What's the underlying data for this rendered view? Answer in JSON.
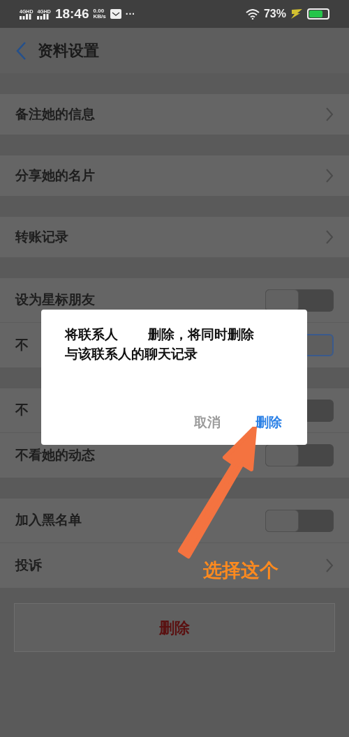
{
  "status_bar": {
    "signals": [
      "4GHD",
      "4GHD"
    ],
    "time": "18:46",
    "speed_value": "0.00",
    "speed_unit": "KB/s",
    "more": "···",
    "battery": "73%"
  },
  "header": {
    "title": "资料设置"
  },
  "groups": [
    {
      "rows": [
        {
          "label": "备注她的信息",
          "kind": "link"
        }
      ]
    },
    {
      "rows": [
        {
          "label": "分享她的名片",
          "kind": "link"
        }
      ]
    },
    {
      "rows": [
        {
          "label": "转账记录",
          "kind": "link"
        }
      ]
    },
    {
      "rows": [
        {
          "label": "设为星标朋友",
          "kind": "toggle",
          "on": false
        },
        {
          "label": "不",
          "kind": "toggle",
          "on": true
        }
      ]
    },
    {
      "rows": [
        {
          "label": "不",
          "kind": "toggle",
          "on": false
        },
        {
          "label": "不看她的动态",
          "kind": "toggle",
          "on": false
        }
      ]
    },
    {
      "rows": [
        {
          "label": "加入黑名单",
          "kind": "toggle",
          "on": false
        },
        {
          "label": "投诉",
          "kind": "link"
        }
      ]
    }
  ],
  "delete_button": "删除",
  "dialog": {
    "message_lines": [
      "将联系人　　 删除，将同时删除",
      "与该联系人的聊天记录"
    ],
    "buttons": [
      {
        "label": "取消",
        "kind": "cancel"
      },
      {
        "label": "删除",
        "kind": "confirm"
      }
    ]
  },
  "annotation": {
    "text": "选择这个"
  }
}
